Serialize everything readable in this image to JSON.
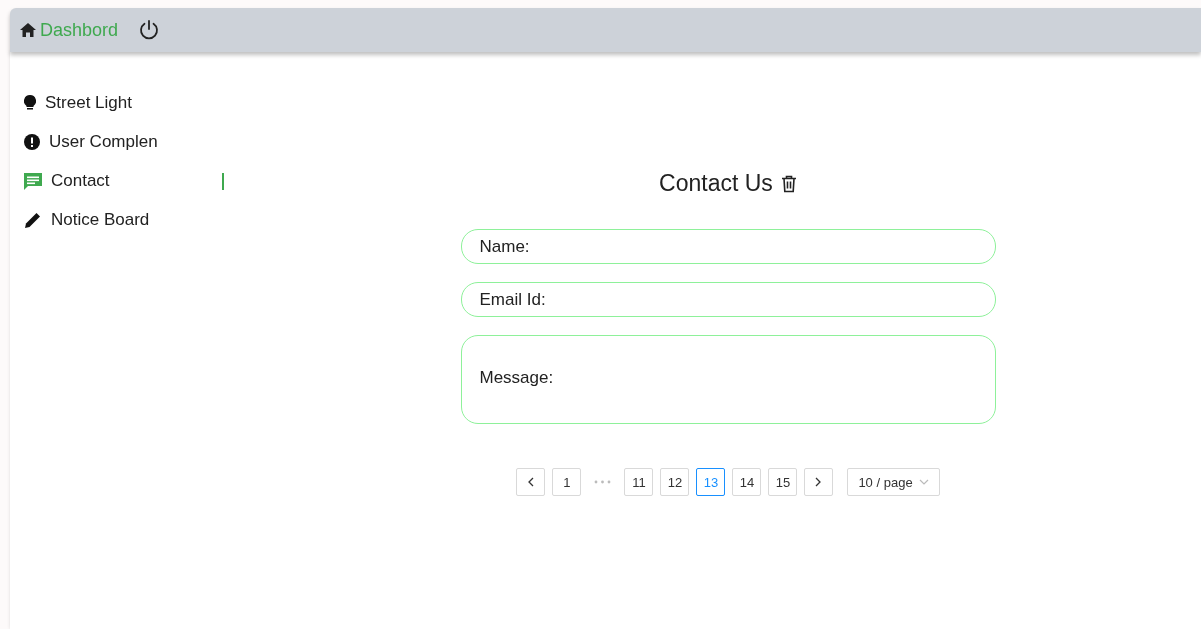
{
  "topbar": {
    "brand": "Dashbord"
  },
  "sidebar": {
    "items": [
      {
        "kind": "light",
        "label": "Street Light",
        "selected": false
      },
      {
        "kind": "alert",
        "label": "User Complen",
        "selected": false
      },
      {
        "kind": "chat",
        "label": "Contact",
        "selected": true
      },
      {
        "kind": "pencil",
        "label": "Notice Board",
        "selected": false
      }
    ]
  },
  "form": {
    "title": "Contact Us",
    "fields": [
      {
        "kind": "line",
        "placeholder": "Name:"
      },
      {
        "kind": "line",
        "placeholder": "Email Id:"
      },
      {
        "kind": "area",
        "placeholder": "Message:"
      }
    ]
  },
  "pagination": {
    "items": [
      {
        "kind": "prev"
      },
      {
        "kind": "page",
        "label": "1",
        "selected": false
      },
      {
        "kind": "ellipsis"
      },
      {
        "kind": "page",
        "label": "11",
        "selected": false
      },
      {
        "kind": "page",
        "label": "12",
        "selected": false
      },
      {
        "kind": "page",
        "label": "13",
        "selected": true
      },
      {
        "kind": "page",
        "label": "14",
        "selected": false
      },
      {
        "kind": "page",
        "label": "15",
        "selected": false
      },
      {
        "kind": "next"
      }
    ],
    "page_size": "10 / page"
  }
}
